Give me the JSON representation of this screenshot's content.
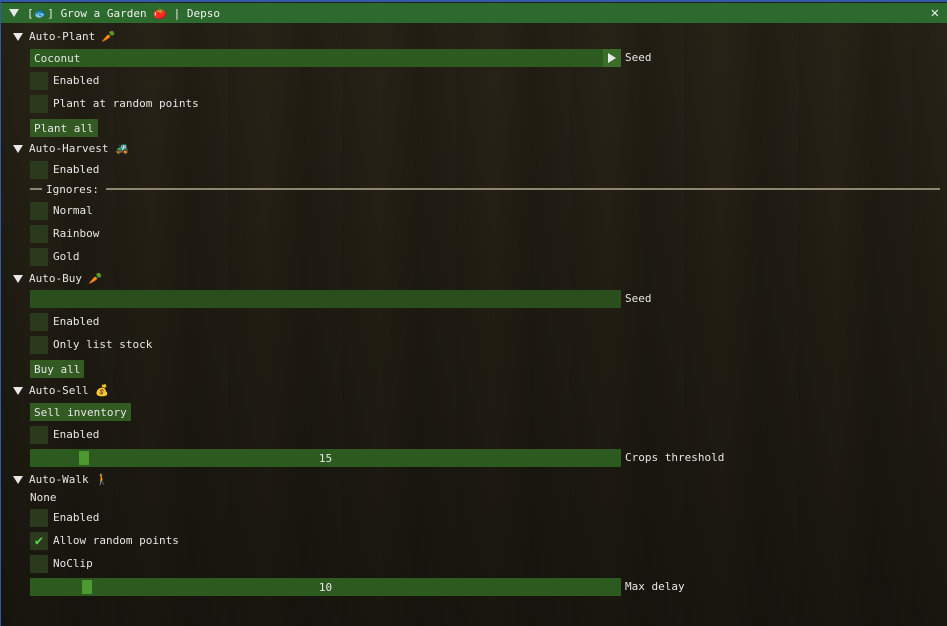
{
  "window": {
    "title": "[🐟] Grow a Garden 🍅 | Depso",
    "close_glyph": "✕"
  },
  "auto_plant": {
    "header": "Auto-Plant 🥕",
    "seed_value": "Coconut",
    "seed_label": "Seed",
    "enabled_label": "Enabled",
    "random_label": "Plant at random points",
    "plant_all_label": "Plant all"
  },
  "auto_harvest": {
    "header": "Auto-Harvest 🚜",
    "enabled_label": "Enabled",
    "ignores_label": "Ignores:",
    "normal_label": "Normal",
    "rainbow_label": "Rainbow",
    "gold_label": "Gold"
  },
  "auto_buy": {
    "header": "Auto-Buy 🥕",
    "seed_value": "",
    "seed_label": "Seed",
    "enabled_label": "Enabled",
    "only_stock_label": "Only list stock",
    "buy_all_label": "Buy all"
  },
  "auto_sell": {
    "header": "Auto-Sell 💰",
    "sell_label": "Sell inventory",
    "enabled_label": "Enabled",
    "threshold_value": "15",
    "threshold_fraction": 0.085,
    "threshold_label": "Crops threshold"
  },
  "auto_walk": {
    "header": "Auto-Walk 🚶",
    "status": "None",
    "enabled_label": "Enabled",
    "random_label": "Allow random points",
    "random_checked": true,
    "noclip_label": "NoClip",
    "delay_value": "10",
    "delay_fraction": 0.09,
    "delay_label": "Max delay"
  },
  "colors": {
    "accent": "#2d6a2d",
    "frame": "#2c5a1f",
    "check": "#5cd04a"
  }
}
